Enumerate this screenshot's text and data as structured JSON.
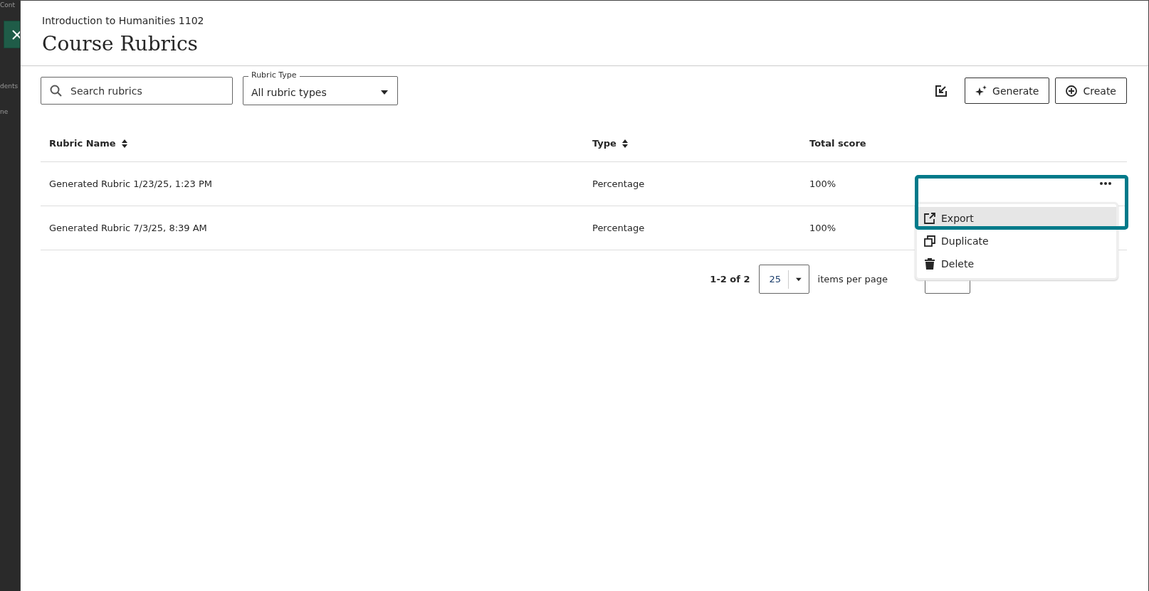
{
  "background_fragments": [
    "Cont",
    "dents",
    "ne"
  ],
  "header": {
    "course": "Introduction to Humanities 1102",
    "title": "Course Rubrics"
  },
  "search": {
    "placeholder": "Search rubrics"
  },
  "type_filter": {
    "label": "Rubric Type",
    "value": "All rubric types"
  },
  "actions": [
    {
      "kind": "import"
    },
    {
      "kind": "generate",
      "label": "Generate"
    },
    {
      "kind": "create",
      "label": "Create"
    }
  ],
  "table": {
    "columns": [
      {
        "label": "Rubric Name",
        "sortable": true
      },
      {
        "label": "Type",
        "sortable": true
      },
      {
        "label": "Total score",
        "sortable": false
      }
    ],
    "rows": [
      {
        "name": "Generated Rubric 1/23/25, 1:23 PM",
        "type": "Percentage",
        "score": "100%",
        "menu_open": true
      },
      {
        "name": "Generated Rubric 7/3/25, 8:39 AM",
        "type": "Percentage",
        "score": "100%",
        "menu_open": false
      }
    ]
  },
  "row_menu": {
    "items": [
      {
        "kind": "export",
        "label": "Export",
        "hovered": true
      },
      {
        "kind": "duplicate",
        "label": "Duplicate",
        "hovered": false
      },
      {
        "kind": "delete",
        "label": "Delete",
        "hovered": false
      }
    ]
  },
  "pagination": {
    "range": "1-2 of 2",
    "per_page": "25",
    "per_page_label": "items per page"
  }
}
